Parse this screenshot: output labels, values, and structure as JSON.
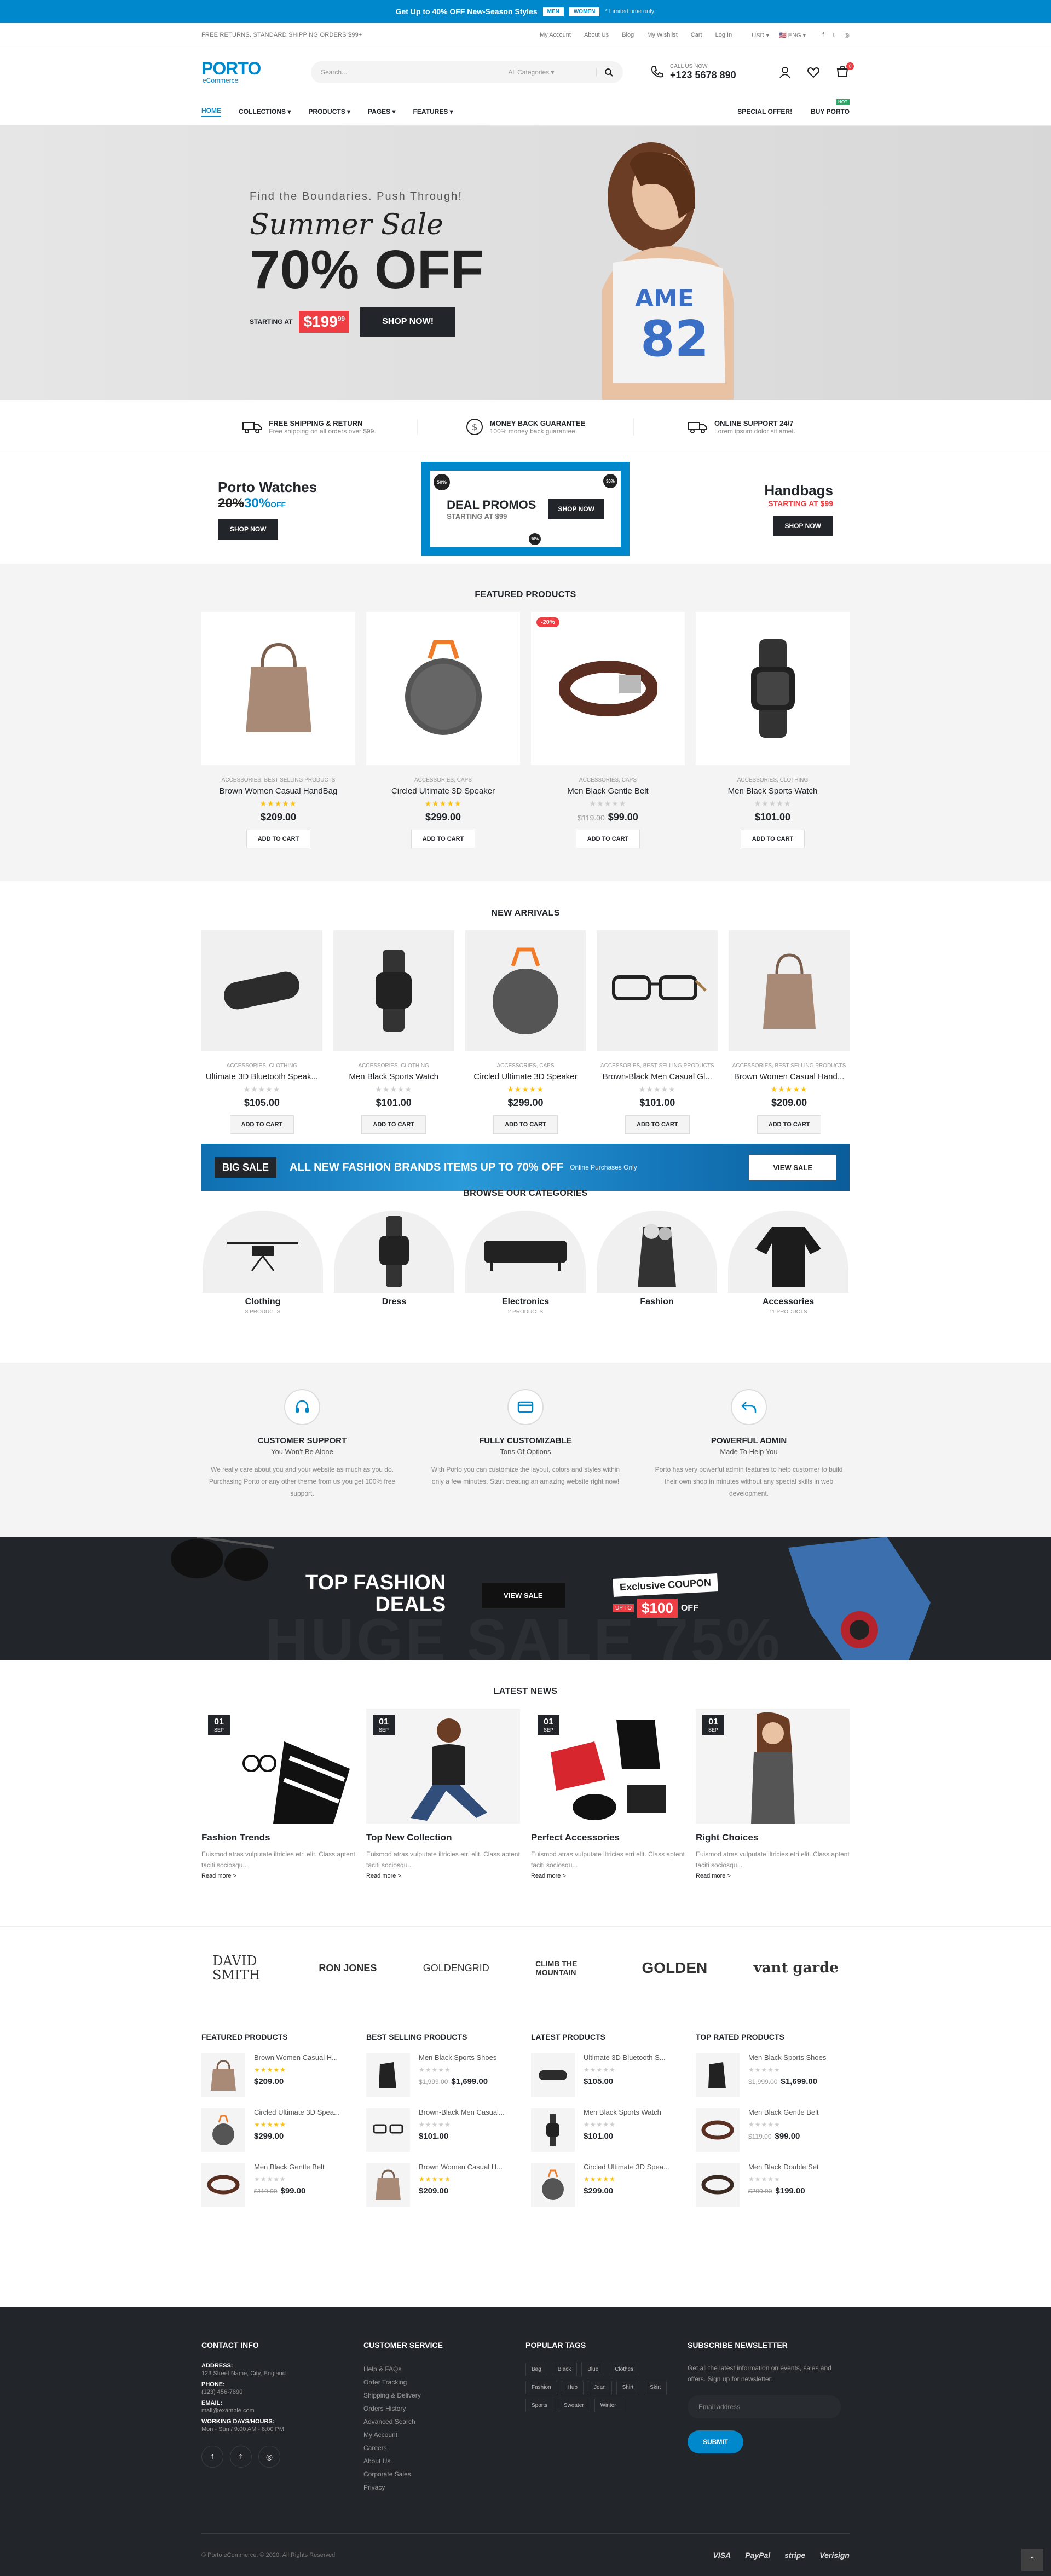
{
  "topbar": {
    "text": "Get Up to 40% OFF New-Season Styles",
    "men": "MEN",
    "women": "WOMEN",
    "note": "* Limited time only."
  },
  "utility": {
    "left": "FREE RETURNS. STANDARD SHIPPING ORDERS $99+",
    "links": [
      "My Account",
      "About Us",
      "Blog",
      "My Wishlist",
      "Cart",
      "Log In"
    ],
    "currency": "USD",
    "language": "ENG"
  },
  "header": {
    "logo": "PORTO",
    "logo_sub": "eCommerce",
    "search_placeholder": "Search...",
    "search_category": "All Categories",
    "call_label": "CALL US NOW",
    "phone": "+123 5678 890",
    "cart_count": "0"
  },
  "nav": {
    "items": [
      "HOME",
      "COLLECTIONS",
      "PRODUCTS",
      "PAGES",
      "FEATURES"
    ],
    "special": "SPECIAL OFFER!",
    "buy": "BUY PORTO",
    "hot": "HOT"
  },
  "hero": {
    "kicker": "Find the Boundaries. Push Through!",
    "title": "Summer Sale",
    "discount": "70% OFF",
    "starting": "STARTING AT",
    "price": "$199",
    "cents": "99",
    "button": "SHOP NOW!"
  },
  "info": [
    {
      "title": "FREE SHIPPING & RETURN",
      "text": "Free shipping on all orders over $99."
    },
    {
      "title": "MONEY BACK GUARANTEE",
      "text": "100% money back guarantee"
    },
    {
      "title": "ONLINE SUPPORT 24/7",
      "text": "Lorem ipsum dolor sit amet."
    }
  ],
  "promos": {
    "watches_title": "Porto Watches",
    "watches_old": "20%",
    "watches_new": "30%",
    "watches_off": "OFF",
    "watches_btn": "SHOP NOW",
    "deal_title": "DEAL PROMOS",
    "deal_sub": "STARTING AT $99",
    "deal_btn": "SHOP NOW",
    "deal_badge": "50%",
    "deal_badge2": "30%",
    "deal_badge3": "10%",
    "bags_title": "Handbags",
    "bags_sub": "STARTING AT $99",
    "bags_btn": "SHOP NOW"
  },
  "featured": {
    "title": "FEATURED PRODUCTS",
    "products": [
      {
        "cat": "ACCESSORIES, BEST SELLING PRODUCTS",
        "name": "Brown Women Casual HandBag",
        "price": "$209.00",
        "old": "",
        "rated": true,
        "sale": ""
      },
      {
        "cat": "ACCESSORIES, CAPS",
        "name": "Circled Ultimate 3D Speaker",
        "price": "$299.00",
        "old": "",
        "rated": true,
        "sale": ""
      },
      {
        "cat": "ACCESSORIES, CAPS",
        "name": "Men Black Gentle Belt",
        "price": "$99.00",
        "old": "$119.00",
        "rated": false,
        "sale": "-20%"
      },
      {
        "cat": "ACCESSORIES, CLOTHING",
        "name": "Men Black Sports Watch",
        "price": "$101.00",
        "old": "",
        "rated": false,
        "sale": ""
      }
    ],
    "atc": "ADD TO CART"
  },
  "arrivals": {
    "title": "NEW ARRIVALS",
    "products": [
      {
        "cat": "ACCESSORIES, CLOTHING",
        "name": "Ultimate 3D Bluetooth Speak...",
        "price": "$105.00",
        "rated": false
      },
      {
        "cat": "ACCESSORIES, CLOTHING",
        "name": "Men Black Sports Watch",
        "price": "$101.00",
        "rated": false
      },
      {
        "cat": "ACCESSORIES, CAPS",
        "name": "Circled Ultimate 3D Speaker",
        "price": "$299.00",
        "rated": true
      },
      {
        "cat": "ACCESSORIES, BEST SELLING PRODUCTS",
        "name": "Brown-Black Men Casual Gl...",
        "price": "$101.00",
        "rated": false
      },
      {
        "cat": "ACCESSORIES, BEST SELLING PRODUCTS",
        "name": "Brown Women Casual Hand...",
        "price": "$209.00",
        "rated": true
      }
    ],
    "atc": "ADD TO CART"
  },
  "bigsale": {
    "tag": "BIG SALE",
    "text": "ALL NEW FASHION BRANDS ITEMS UP TO 70% OFF",
    "sub": "Online Purchases Only",
    "btn": "VIEW SALE"
  },
  "categories": {
    "title": "BROWSE OUR CATEGORIES",
    "items": [
      {
        "name": "Clothing",
        "count": "8 PRODUCTS"
      },
      {
        "name": "Dress",
        "count": ""
      },
      {
        "name": "Electronics",
        "count": "2 PRODUCTS"
      },
      {
        "name": "Fashion",
        "count": ""
      },
      {
        "name": "Accessories",
        "count": "11 PRODUCTS"
      }
    ]
  },
  "features": [
    {
      "title": "CUSTOMER SUPPORT",
      "sub": "You Won't Be Alone",
      "text": "We really care about you and your website as much as you do. Purchasing Porto or any other theme from us you get 100% free support."
    },
    {
      "title": "FULLY CUSTOMIZABLE",
      "sub": "Tons Of Options",
      "text": "With Porto you can customize the layout, colors and styles within only a few minutes. Start creating an amazing website right now!"
    },
    {
      "title": "POWERFUL ADMIN",
      "sub": "Made To Help You",
      "text": "Porto has very powerful admin features to help customer to build their own shop in minutes without any special skills in web development."
    }
  ],
  "deals": {
    "title1": "TOP FASHION",
    "title2": "DEALS",
    "btn": "VIEW SALE",
    "coupon": "Exclusive COUPON",
    "upto": "UP TO",
    "amount": "$100",
    "off": "OFF",
    "ghost": "HUGE SALE 75%"
  },
  "news": {
    "title": "LATEST NEWS",
    "posts": [
      {
        "day": "01",
        "mon": "SEP",
        "title": "Fashion Trends",
        "text": "Euismod atras vulputate iltricies etri elit. Class aptent taciti sociosqu...",
        "more": "Read more >"
      },
      {
        "day": "01",
        "mon": "SEP",
        "title": "Top New Collection",
        "text": "Euismod atras vulputate iltricies etri elit. Class aptent taciti sociosqu...",
        "more": "Read more >"
      },
      {
        "day": "01",
        "mon": "SEP",
        "title": "Perfect Accessories",
        "text": "Euismod atras vulputate iltricies etri elit. Class aptent taciti sociosqu...",
        "more": "Read more >"
      },
      {
        "day": "01",
        "mon": "SEP",
        "title": "Right Choices",
        "text": "Euismod atras vulputate iltricies etri elit. Class aptent taciti sociosqu...",
        "more": "Read more >"
      }
    ]
  },
  "brands": [
    "DAVID SMITH",
    "RON JONES",
    "GOLDENGRID",
    "CLIMB THE MOUNTAIN",
    "GOLDEN",
    "vant garde"
  ],
  "lists": [
    {
      "title": "FEATURED PRODUCTS",
      "items": [
        {
          "name": "Brown Women Casual H...",
          "price": "$209.00",
          "old": "",
          "rated": true
        },
        {
          "name": "Circled Ultimate 3D Spea...",
          "price": "$299.00",
          "old": "",
          "rated": true
        },
        {
          "name": "Men Black Gentle Belt",
          "price": "$99.00",
          "old": "$119.00",
          "rated": false
        }
      ]
    },
    {
      "title": "BEST SELLING PRODUCTS",
      "items": [
        {
          "name": "Men Black Sports Shoes",
          "price": "$1,699.00",
          "old": "$1,999.00",
          "rated": false
        },
        {
          "name": "Brown-Black Men Casual...",
          "price": "$101.00",
          "old": "",
          "rated": false
        },
        {
          "name": "Brown Women Casual H...",
          "price": "$209.00",
          "old": "",
          "rated": true
        }
      ]
    },
    {
      "title": "LATEST PRODUCTS",
      "items": [
        {
          "name": "Ultimate 3D Bluetooth S...",
          "price": "$105.00",
          "old": "",
          "rated": false
        },
        {
          "name": "Men Black Sports Watch",
          "price": "$101.00",
          "old": "",
          "rated": false
        },
        {
          "name": "Circled Ultimate 3D Spea...",
          "price": "$299.00",
          "old": "",
          "rated": true
        }
      ]
    },
    {
      "title": "TOP RATED PRODUCTS",
      "items": [
        {
          "name": "Men Black Sports Shoes",
          "price": "$1,699.00",
          "old": "$1,999.00",
          "rated": false
        },
        {
          "name": "Men Black Gentle Belt",
          "price": "$99.00",
          "old": "$119.00",
          "rated": false
        },
        {
          "name": "Men Black Double Set",
          "price": "$199.00",
          "old": "$299.00",
          "rated": false
        }
      ]
    }
  ],
  "footer": {
    "contact_title": "CONTACT INFO",
    "address_k": "ADDRESS:",
    "address": "123 Street Name, City, England",
    "phone_k": "PHONE:",
    "phone": "(123) 456-7890",
    "email_k": "EMAIL:",
    "email": "mail@example.com",
    "hours_k": "WORKING DAYS/HOURS:",
    "hours": "Mon - Sun / 9:00 AM - 8:00 PM",
    "service_title": "CUSTOMER SERVICE",
    "service": [
      "Help & FAQs",
      "Order Tracking",
      "Shipping & Delivery",
      "Orders History",
      "Advanced Search",
      "My Account",
      "Careers",
      "About Us",
      "Corporate Sales",
      "Privacy"
    ],
    "tags_title": "POPULAR TAGS",
    "tags": [
      "Bag",
      "Black",
      "Blue",
      "Clothes",
      "Fashion",
      "Hub",
      "Jean",
      "Shirt",
      "Skirt",
      "Sports",
      "Sweater",
      "Winter"
    ],
    "news_title": "SUBSCRIBE NEWSLETTER",
    "news_text": "Get all the latest information on events, sales and offers. Sign up for newsletter:",
    "news_placeholder": "Email address",
    "news_btn": "SUBMIT",
    "copyright": "© Porto eCommerce. © 2020. All Rights Reserved",
    "payments": [
      "VISA",
      "PayPal",
      "stripe",
      "Verisign"
    ]
  }
}
